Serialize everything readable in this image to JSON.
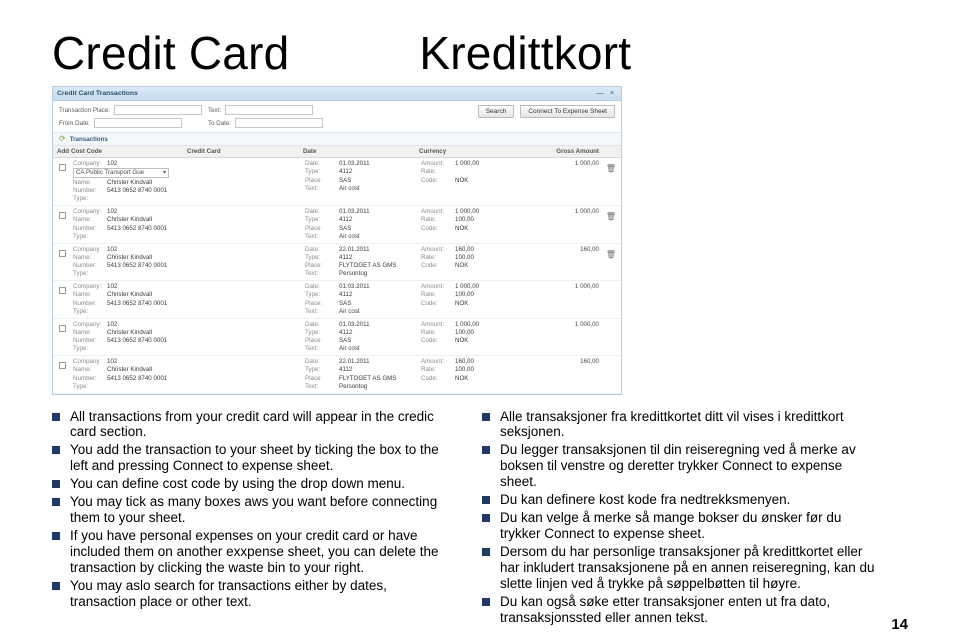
{
  "page": {
    "title_en": "Credit Card",
    "title_no": "Kredittkort",
    "number": "14"
  },
  "window": {
    "title": "Credit Card Transactions",
    "filters": {
      "place_label": "Transaction Place:",
      "from_label": "From Date:",
      "text_label": "Text:",
      "to_label": "To Date:"
    },
    "search_btn": "Search",
    "connect_btn": "Connect To Expense Sheet",
    "tab": "Transactions",
    "headers": {
      "add": "Add",
      "cost": "Cost Code",
      "cc": "Credit Card",
      "date": "Date",
      "cur": "Currency",
      "gross": "Gross Amount"
    },
    "kv_labels": {
      "company": "Company:",
      "name": "Name:",
      "number": "Number:",
      "type_cost": "Type:",
      "date": "Date:",
      "type_cc": "Type:",
      "place": "Place:",
      "text": "Text:",
      "amount": "Amount:",
      "rate": "Rate:",
      "code": "Code:"
    },
    "dropdown": {
      "value": "CA Public Transport Gue"
    },
    "rows": [
      {
        "company": "102",
        "name": "Christer Kindvall",
        "number": "5413 0652 8740 0001",
        "date": "01.03.2011",
        "type_cc": "4112",
        "place": "SAS",
        "text": "Air cost",
        "amount": "1 000,00",
        "code": "NOK",
        "gross": "1 000,00",
        "trash": true
      },
      {
        "company": "102",
        "name": "Christer Kindvall",
        "number": "5413 0652 8740 0001",
        "date": "01.03.2011",
        "type_cc": "4112",
        "place": "SAS",
        "text": "Air cost",
        "amount": "1 000,00",
        "rate": "100,00",
        "code": "NOK",
        "gross": "1 000,00",
        "trash": true
      },
      {
        "company": "102",
        "name": "Christer Kindvall",
        "number": "5413 0652 8740 0001",
        "date": "22.01.2011",
        "type_cc": "4112",
        "place": "FLYTOGET AS GMS",
        "text": "Persontog",
        "amount": "160,00",
        "rate": "100,00",
        "code": "NOK",
        "gross": "160,00",
        "trash": true
      },
      {
        "company": "102",
        "name": "Christer Kindvall",
        "number": "5413 0652 8740 0001",
        "date": "01.03.2011",
        "type_cc": "4112",
        "place": "SAS",
        "text": "Air cost",
        "amount": "1 000,00",
        "rate": "100,00",
        "code": "NOK",
        "gross": "1 000,00",
        "trash": false
      },
      {
        "company": "102",
        "name": "Christer Kindvall",
        "number": "5413 0652 8740 0001",
        "date": "01.03.2011",
        "type_cc": "4112",
        "place": "SAS",
        "text": "Air cost",
        "amount": "1 000,00",
        "rate": "100,00",
        "code": "NOK",
        "gross": "1 000,00",
        "trash": false
      },
      {
        "company": "102",
        "name": "Christer Kindvall",
        "number": "5413 0652 8740 0001",
        "date": "22.01.2011",
        "type_cc": "4112",
        "place": "FLYTOGET AS GMS",
        "text": "Persontog",
        "amount": "160,00",
        "rate": "100,00",
        "code": "NOK",
        "gross": "160,00",
        "trash": false
      }
    ]
  },
  "bullets": {
    "en": [
      "All transactions from your credit card will appear in the credic card section.",
      "You add the transaction to your sheet by ticking the box to the left and pressing Connect to expense sheet.",
      "You can define cost code by using the drop down menu.",
      "You may tick as many boxes aws you want before connecting them to your sheet.",
      "If you have personal expenses on your credit card or have included them on another exxpense sheet, you can delete the transaction by clicking the waste bin to your right.",
      "You may aslo search for transactions either by dates, transaction place or other text."
    ],
    "no": [
      "Alle transaksjoner fra kredittkortet ditt vil vises i kredittkort seksjonen.",
      "Du legger transaksjonen til din reiseregning ved å merke av boksen til venstre og deretter trykker Connect to expense sheet.",
      "Du kan definere kost kode fra nedtrekksmenyen.",
      "Du kan velge å merke så mange bokser du ønsker før du trykker Connect to expense sheet.",
      "Dersom du har personlige transaksjoner på kredittkortet eller har inkludert transaksjonene på en annen reiseregning, kan du slette linjen ved å trykke på søppelbøtten til høyre.",
      "Du kan også søke etter transaksjoner enten ut fra dato, transaksjonssted eller annen tekst."
    ]
  }
}
